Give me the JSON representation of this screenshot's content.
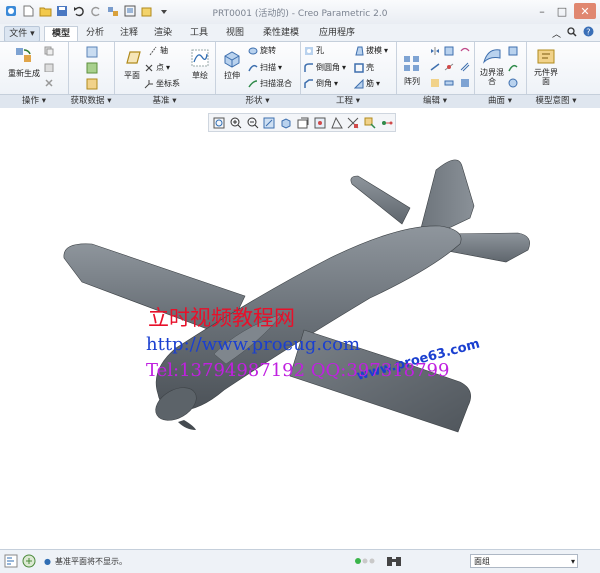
{
  "window": {
    "title": "PRT0001 (活动的) - Creo Parametric 2.0"
  },
  "tabs": [
    "文件",
    "模型",
    "分析",
    "注释",
    "渲染",
    "工具",
    "视图",
    "柔性建模",
    "应用程序"
  ],
  "active_tab": "模型",
  "ribbon": {
    "operations": {
      "regenerate": "重新生成",
      "group": "操作"
    },
    "get_data": {
      "group": "获取数据"
    },
    "datum": {
      "plane": "平面",
      "axis": "轴",
      "point": "点",
      "csys": "坐标系",
      "sketch": "草绘",
      "group": "基准"
    },
    "shapes": {
      "extrude": "拉伸",
      "revolve": "旋转",
      "sweep": "扫描",
      "swept_blend": "扫描混合",
      "group": "形状"
    },
    "engineering": {
      "hole": "孔",
      "round": "倒圆角",
      "chamfer": "倒角",
      "draft": "拔模",
      "shell": "壳",
      "rib": "筋",
      "group": "工程"
    },
    "editing": {
      "pattern": "阵列",
      "group": "编辑"
    },
    "surfaces": {
      "boundary_blend": "边界混合",
      "group": "曲面"
    },
    "model_intent": {
      "component_interface": "元件界面",
      "group": "模型意图"
    }
  },
  "watermark": {
    "line1": "立时视频教程网",
    "line2": "http://www.proeug.com",
    "line3": "Tel:13794987192  QQ:397318799",
    "wing_text": "www.proe63.com"
  },
  "status": {
    "message": "基准平面将不显示。",
    "filter_value": "面组"
  },
  "colors": {
    "accent": "#2f6db3",
    "model_gray": "#6e757c",
    "watermark_red": "#e8102a",
    "watermark_blue": "#1a3fd0",
    "watermark_magenta": "#c020e0"
  }
}
